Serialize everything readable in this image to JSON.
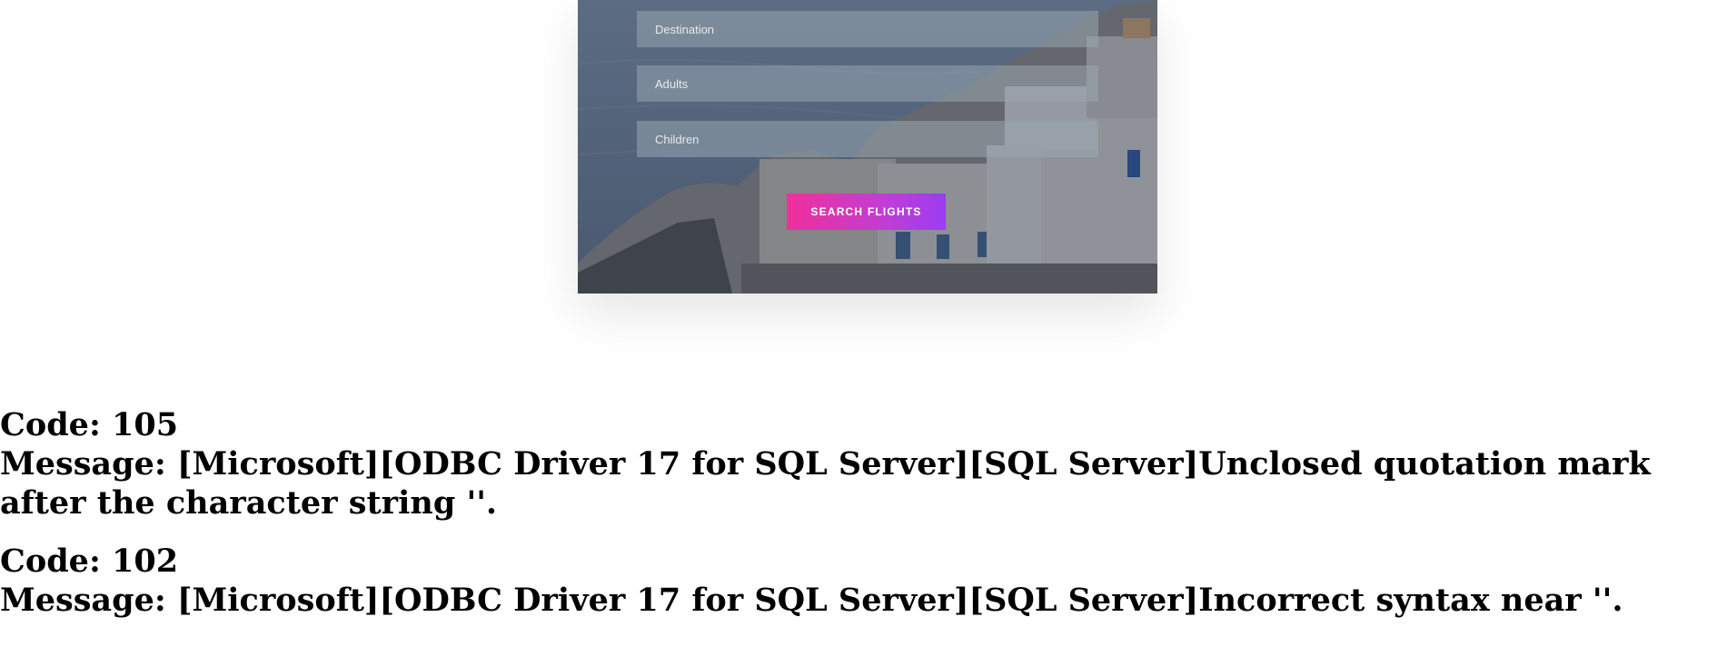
{
  "form": {
    "destination_placeholder": "Destination",
    "adults_placeholder": "Adults",
    "children_placeholder": "Children",
    "submit_label": "SEARCH FLIGHTS"
  },
  "errors": [
    {
      "code_line": "Code: 105",
      "message_line": "Message: [Microsoft][ODBC Driver 17 for SQL Server][SQL Server]Unclosed quotation mark after the character string ''."
    },
    {
      "code_line": "Code: 102",
      "message_line": "Message: [Microsoft][ODBC Driver 17 for SQL Server][SQL Server]Incorrect syntax near ''."
    }
  ],
  "colors": {
    "button_gradient_start": "#f0309a",
    "button_gradient_end": "#9b3df3"
  }
}
